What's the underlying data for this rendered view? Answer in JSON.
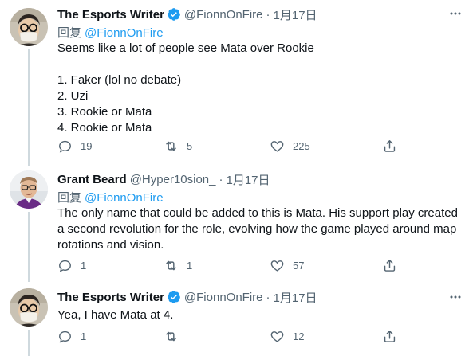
{
  "tweets": [
    {
      "name": "The Esports Writer",
      "verified": true,
      "handle": "@FionnOnFire",
      "dot": "·",
      "date": "1月17日",
      "reply_prefix": "回复",
      "reply_mention": "@FionnOnFire",
      "lines": [
        "Seems like a lot of people see Mata over Rookie",
        "",
        "1. Faker (lol no debate)",
        "2. Uzi",
        "3. Rookie or Mata",
        "4. Rookie or Mata"
      ],
      "reply_count": "19",
      "retweet_count": "5",
      "like_count": "225"
    },
    {
      "name": "Grant Beard",
      "verified": false,
      "handle": "@Hyper10sion_",
      "dot": "·",
      "date": "1月17日",
      "reply_prefix": "回复",
      "reply_mention": "@FionnOnFire",
      "lines": [
        "The only name that could be added to this is Mata. His support play created",
        "a second revolution for the role, evolving how the game played around map",
        "rotations and vision."
      ],
      "reply_count": "1",
      "retweet_count": "1",
      "like_count": "57"
    },
    {
      "name": "The Esports Writer",
      "verified": true,
      "handle": "@FionnOnFire",
      "dot": "·",
      "date": "1月17日",
      "lines": [
        "Yea, I have Mata at 4."
      ],
      "reply_count": "1",
      "retweet_count": "",
      "like_count": "12"
    }
  ],
  "colors": {
    "accent": "#1d9bf0",
    "secondary_text": "#536471",
    "divider": "#e6ecf0"
  },
  "icons": [
    "verified-badge-icon",
    "more-icon",
    "reply-icon",
    "retweet-icon",
    "like-icon",
    "share-icon"
  ]
}
